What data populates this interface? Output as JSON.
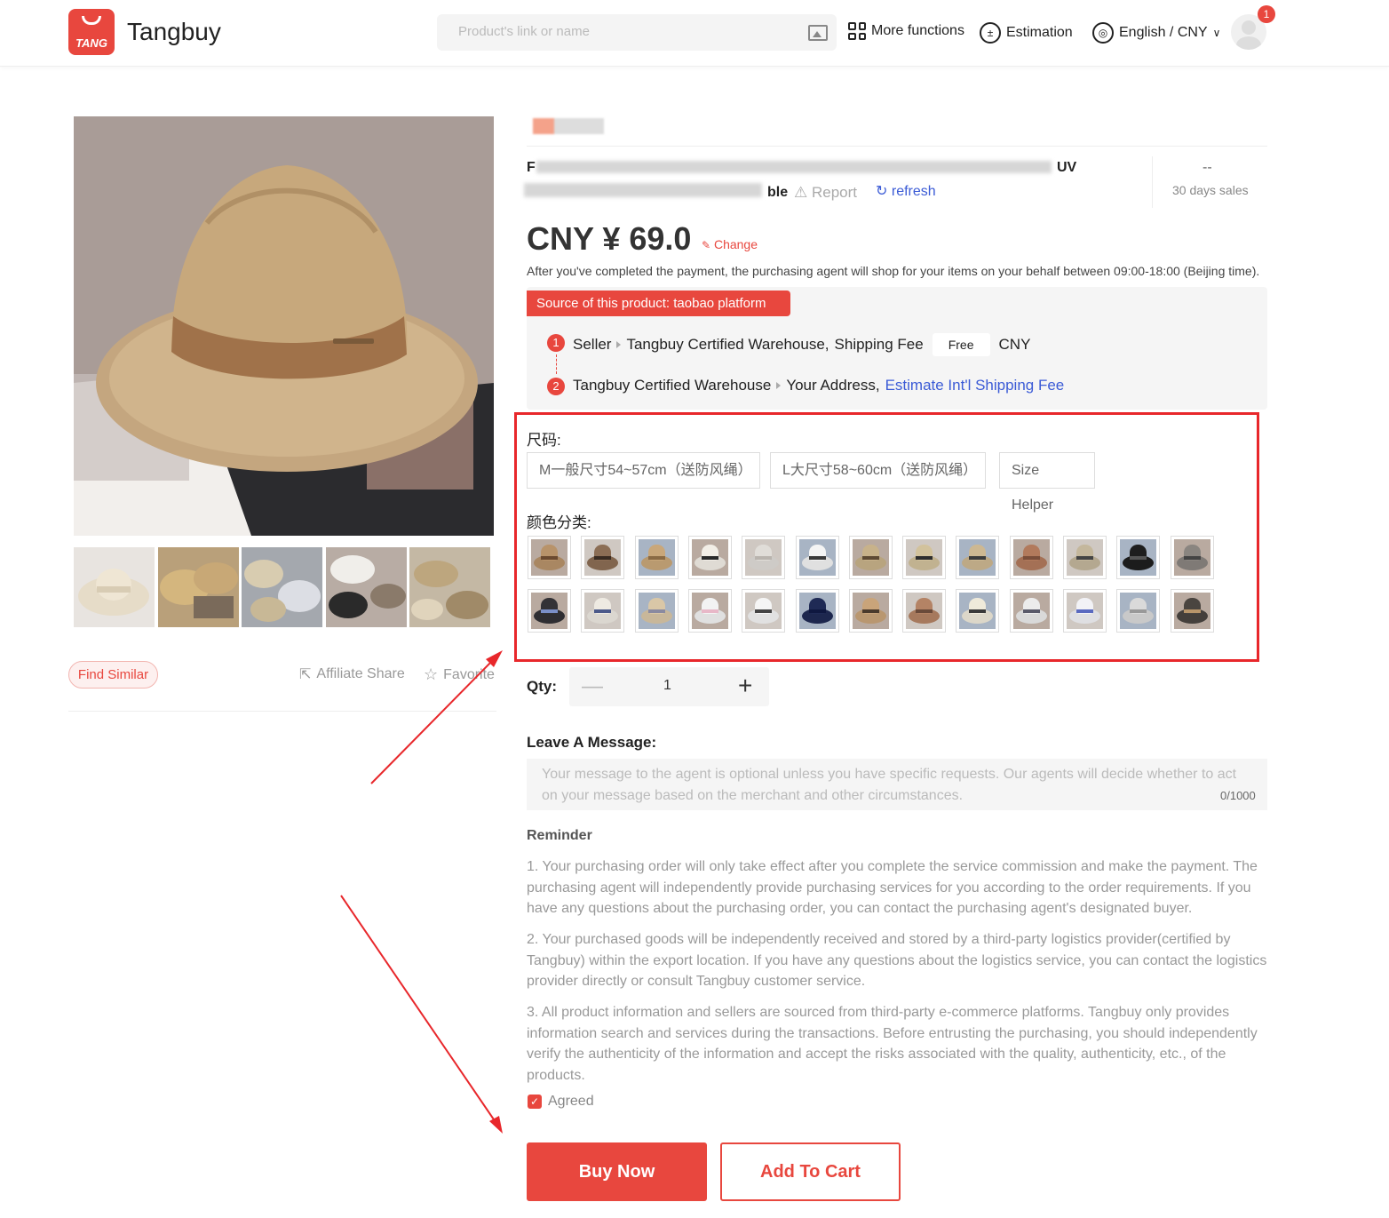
{
  "header": {
    "logo_tag": "TANG",
    "brand": "Tangbuy",
    "search_placeholder": "Product's link or name",
    "nav": {
      "more_functions": "More functions",
      "estimation": "Estimation",
      "language_currency": "English / CNY"
    },
    "notification_count": "1"
  },
  "gallery": {
    "find_similar": "Find Similar",
    "affiliate_share": "Affiliate Share",
    "favorite": "Favorite"
  },
  "product": {
    "title_visible_start": "F",
    "title_visible_end": "UV",
    "title_line2_end": "ble",
    "report": "Report",
    "refresh": "refresh",
    "sales_value": "--",
    "sales_label": "30 days sales",
    "price": "CNY ¥ 69.0",
    "change": "Change",
    "purchase_note": "After you've completed the payment, the purchasing agent will shop for your items on your behalf between 09:00-18:00 (Beijing time)."
  },
  "source": {
    "tag": "Source of this product:   taobao platform",
    "step1_num": "1",
    "step1_seller": "Seller",
    "step1_warehouse": "Tangbuy Certified Warehouse,",
    "step1_shipping": "Shipping Fee",
    "step1_free": "Free",
    "step1_currency": "CNY",
    "step2_num": "2",
    "step2_warehouse": "Tangbuy Certified Warehouse",
    "step2_address": "Your Address,",
    "step2_estimate": "Estimate Int'l Shipping Fee"
  },
  "options": {
    "size_label": "尺码:",
    "sizes": [
      "M一般尺寸54~57cm（送防风绳）",
      "L大尺寸58~60cm（送防风绳）"
    ],
    "size_helper": "Size Helper",
    "color_label": "颜色分类:",
    "color_swatches_row1": [
      "#b8936a",
      "#8c6e55",
      "#c9a77a",
      "#f2eee6",
      "#e0ddd8",
      "#f4f4f4",
      "#c8b28a",
      "#d2c29c",
      "#cdb892",
      "#b27a5c",
      "#c4b79c",
      "#1e1e1e",
      "#8a8580"
    ],
    "color_swatches_row2": [
      "#333236",
      "#eeeae2",
      "#d9c7a7",
      "#f3f3f3",
      "#f5f5f5",
      "#1f2a55",
      "#c9a47a",
      "#b48365",
      "#efeada",
      "#ececec",
      "#f2f2f6",
      "#dadada",
      "#4a4540"
    ],
    "swatch_band_row1": [
      "#6b4a30",
      "#3a2c22",
      "#8a6a44",
      "#2a2a2a",
      "#b9b4ae",
      "#3a3a3a",
      "#5e4a34",
      "#2e2e2e",
      "#3c3c3c",
      "#7a4e3a",
      "#444",
      "#555",
      "#444"
    ],
    "swatch_band_row2": [
      "#7a8fc8",
      "#4c5a8a",
      "#8a8aa0",
      "#e8b8c8",
      "#444",
      "#0f1840",
      "#4a3a2c",
      "#6a4a3a",
      "#3a3a3a",
      "#5a5a6a",
      "#5a6ac0",
      "#999",
      "#b8956a"
    ]
  },
  "qty": {
    "label": "Qty:",
    "minus": "—",
    "value": "1",
    "plus": "+"
  },
  "message": {
    "label": "Leave A Message:",
    "placeholder": "Your message to the agent is optional unless you have specific requests. Our agents will decide whether to act on your message based on the merchant and other circumstances.",
    "count": "0/1000"
  },
  "reminder": {
    "title": "Reminder",
    "items": [
      "1. Your purchasing order will only take effect after you complete the service commission and make the payment. The purchasing agent will independently provide purchasing services for you according to the order requirements. If you have any questions about the purchasing order, you can contact the purchasing agent's designated buyer.",
      "2. Your purchased goods will be independently received and stored by a third-party logistics provider(certified by Tangbuy) within the export location. If you have any questions about the logistics service, you can contact the logistics provider directly or consult Tangbuy customer service.",
      "3. All product information and sellers are sourced from third-party e-commerce platforms. Tangbuy only provides information search and services during the transactions. Before entrusting the purchasing, you should independently verify the authenticity of the information and accept the risks associated with the quality, authenticity, etc., of the products."
    ],
    "agreed": "Agreed"
  },
  "actions": {
    "buy_now": "Buy Now",
    "add_to_cart": "Add To Cart"
  },
  "colors": {
    "accent": "#e8473e",
    "link": "#3b5bd6",
    "annotation": "#e8272b"
  }
}
